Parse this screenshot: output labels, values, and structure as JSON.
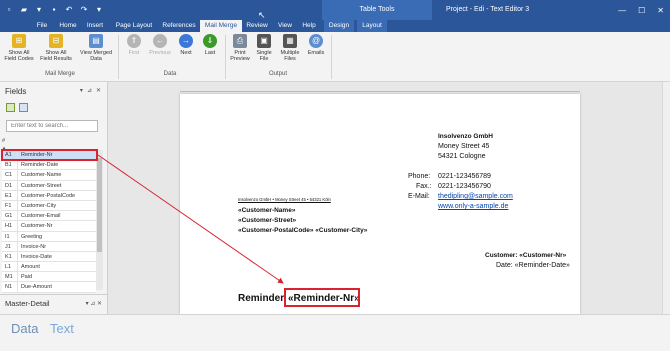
{
  "window": {
    "title": "Project - Edi - Text Editor 3",
    "context_group": "Table Tools",
    "controls": [
      "—",
      "☐",
      "✕"
    ]
  },
  "ribbon_tabs": [
    "File",
    "Home",
    "Insert",
    "Page Layout",
    "References",
    "Mail Merge",
    "Review",
    "View",
    "Help",
    "Design",
    "Layout"
  ],
  "ribbon": {
    "groups": {
      "mail_merge": {
        "label": "Mail Merge",
        "buttons": [
          {
            "label": "Show All\nField Codes",
            "icon": "field-codes-icon"
          },
          {
            "label": "Show All\nField Results",
            "icon": "field-results-icon"
          },
          {
            "label": "View Merged\nData",
            "icon": "view-merged-icon"
          }
        ]
      },
      "data": {
        "label": "Data",
        "buttons": [
          {
            "label": "First",
            "icon": "first-icon",
            "disabled": true
          },
          {
            "label": "Previous",
            "icon": "previous-icon",
            "disabled": true
          },
          {
            "label": "Next",
            "icon": "next-icon",
            "disabled": false
          },
          {
            "label": "Last",
            "icon": "last-icon",
            "disabled": false
          }
        ]
      },
      "output": {
        "label": "Output",
        "buttons": [
          {
            "label": "Print\nPreview",
            "icon": "print-preview-icon"
          },
          {
            "label": "Single\nFile",
            "icon": "single-file-icon"
          },
          {
            "label": "Multiple\nFiles",
            "icon": "multiple-files-icon"
          },
          {
            "label": "Emails",
            "icon": "emails-icon"
          }
        ]
      }
    }
  },
  "fields_panel": {
    "title": "Fields",
    "search_placeholder": "Enter text to search...",
    "columns": [
      "#",
      "▲"
    ],
    "rows": [
      {
        "id": "A1",
        "name": "Reminder-Nr"
      },
      {
        "id": "B1",
        "name": "Reminder-Date"
      },
      {
        "id": "C1",
        "name": "Customer-Name"
      },
      {
        "id": "D1",
        "name": "Customer-Street"
      },
      {
        "id": "E1",
        "name": "Customer-PostalCode"
      },
      {
        "id": "F1",
        "name": "Customer-City"
      },
      {
        "id": "G1",
        "name": "Customer-Email"
      },
      {
        "id": "H1",
        "name": "Customer-Nr"
      },
      {
        "id": "I1",
        "name": "Greeting"
      },
      {
        "id": "J1",
        "name": "Invoice-Nr"
      },
      {
        "id": "K1",
        "name": "Invoice-Date"
      },
      {
        "id": "L1",
        "name": "Amount"
      },
      {
        "id": "M1",
        "name": "Paid"
      },
      {
        "id": "N1",
        "name": "Due-Amount"
      }
    ],
    "selected_row": "A1"
  },
  "master_detail": {
    "title": "Master-Detail"
  },
  "document": {
    "sender_company": "Insolvenzo GmbH",
    "sender_street": "Money Street 45",
    "sender_city": "54321 Cologne",
    "phone_label": "Phone:",
    "phone": "0221-123456789",
    "fax_label": "Fax.:",
    "fax": "0221-123456790",
    "email_label": "E-Mail:",
    "email": "thedipling@sample.com",
    "website": "www.only-a-sample.de",
    "return_line": "Insolvenzo GmbH • Money Street 45 • 54321 Köln",
    "cust_name": "«Customer-Name»",
    "cust_street": "«Customer-Street»",
    "cust_postal_city": "«Customer-PostalCode» «Customer-City»",
    "customer_line": "Customer: «Customer-Nr»",
    "date_line": "Date: «Reminder-Date»",
    "heading_prefix": "Reminder",
    "heading_field": "«Reminder-Nr»"
  },
  "bottom_tabs": [
    "Data",
    "Text"
  ],
  "colors": {
    "accent": "#2b579a",
    "highlight": "#d9232e",
    "link": "#0645ad"
  }
}
